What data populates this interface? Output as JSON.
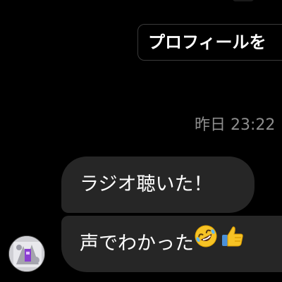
{
  "header": {
    "profile_button_label": "プロフィールを"
  },
  "conversation": {
    "timestamp": "昨日 23:22",
    "messages": [
      {
        "text": "ラジオ聴いた！"
      },
      {
        "text": "声でわかった",
        "emojis": [
          "rolling-on-floor-laughing",
          "thumbs-up"
        ]
      }
    ]
  },
  "colors": {
    "background": "#000000",
    "bubble": "#262626",
    "timestamp": "#8e8e8e",
    "button_border": "#3a3a3a",
    "text": "#ffffff"
  }
}
